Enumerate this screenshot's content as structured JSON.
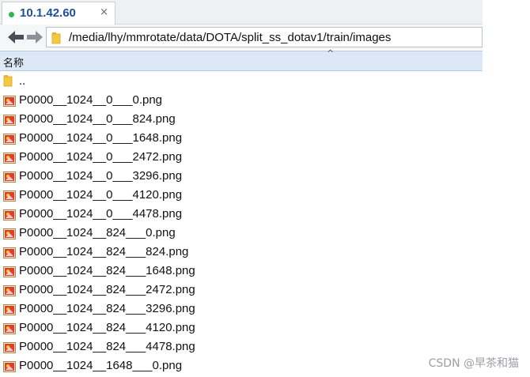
{
  "tab": {
    "title": "10.1.42.60",
    "close": "×",
    "status_color": "#2db84d"
  },
  "address_bar": {
    "path": "/media/lhy/mmrotate/data/DOTA/split_ss_dotav1/train/images",
    "back_icon": "arrow-left-icon",
    "forward_icon": "arrow-right-icon"
  },
  "columns": {
    "name": "名称",
    "sort_indicator": "^"
  },
  "files": [
    {
      "name": "..",
      "type": "parent-folder"
    },
    {
      "name": "P0000__1024__0___0.png",
      "type": "image"
    },
    {
      "name": "P0000__1024__0___824.png",
      "type": "image"
    },
    {
      "name": "P0000__1024__0___1648.png",
      "type": "image"
    },
    {
      "name": "P0000__1024__0___2472.png",
      "type": "image"
    },
    {
      "name": "P0000__1024__0___3296.png",
      "type": "image"
    },
    {
      "name": "P0000__1024__0___4120.png",
      "type": "image"
    },
    {
      "name": "P0000__1024__0___4478.png",
      "type": "image"
    },
    {
      "name": "P0000__1024__824___0.png",
      "type": "image"
    },
    {
      "name": "P0000__1024__824___824.png",
      "type": "image"
    },
    {
      "name": "P0000__1024__824___1648.png",
      "type": "image"
    },
    {
      "name": "P0000__1024__824___2472.png",
      "type": "image"
    },
    {
      "name": "P0000__1024__824___3296.png",
      "type": "image"
    },
    {
      "name": "P0000__1024__824___4120.png",
      "type": "image"
    },
    {
      "name": "P0000__1024__824___4478.png",
      "type": "image"
    },
    {
      "name": "P0000__1024__1648___0.png",
      "type": "image"
    }
  ],
  "watermark": "CSDN @早茶和猫"
}
